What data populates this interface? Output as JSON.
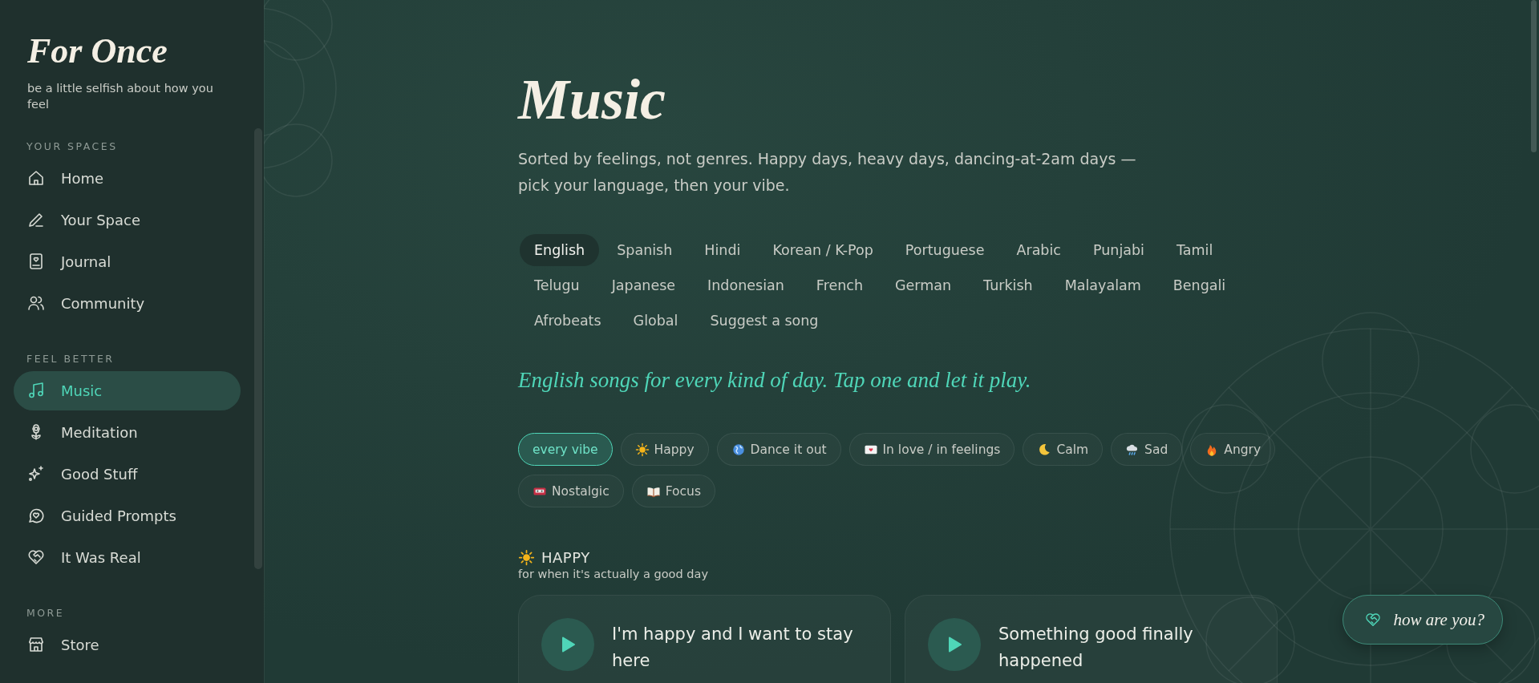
{
  "brand": {
    "title": "For Once",
    "tagline": "be a little selfish about how you feel"
  },
  "sidebar": {
    "sections": [
      {
        "heading": "YOUR SPACES",
        "items": [
          {
            "label": "Home",
            "kind": "home",
            "selected": false
          },
          {
            "label": "Your Space",
            "kind": "pencil",
            "selected": false
          },
          {
            "label": "Journal",
            "kind": "journal",
            "selected": false
          },
          {
            "label": "Community",
            "kind": "people",
            "selected": false
          }
        ]
      },
      {
        "heading": "FEEL BETTER",
        "items": [
          {
            "label": "Music",
            "kind": "music",
            "selected": true
          },
          {
            "label": "Meditation",
            "kind": "flower",
            "selected": false
          },
          {
            "label": "Good Stuff",
            "kind": "sparkles",
            "selected": false
          },
          {
            "label": "Guided Prompts",
            "kind": "chat",
            "selected": false
          },
          {
            "label": "It Was Real",
            "kind": "heart",
            "selected": false
          }
        ]
      },
      {
        "heading": "MORE",
        "items": [
          {
            "label": "Store",
            "kind": "store",
            "selected": false
          }
        ]
      }
    ]
  },
  "page": {
    "title": "Music",
    "intro": "Sorted by feelings, not genres. Happy days, heavy days, dancing-at-2am days — pick your language, then your vibe.",
    "languages": [
      {
        "label": "English",
        "selected": true
      },
      {
        "label": "Spanish",
        "selected": false
      },
      {
        "label": "Hindi",
        "selected": false
      },
      {
        "label": "Korean / K-Pop",
        "selected": false
      },
      {
        "label": "Portuguese",
        "selected": false
      },
      {
        "label": "Arabic",
        "selected": false
      },
      {
        "label": "Punjabi",
        "selected": false
      },
      {
        "label": "Tamil",
        "selected": false
      },
      {
        "label": "Telugu",
        "selected": false
      },
      {
        "label": "Japanese",
        "selected": false
      },
      {
        "label": "Indonesian",
        "selected": false
      },
      {
        "label": "French",
        "selected": false
      },
      {
        "label": "German",
        "selected": false
      },
      {
        "label": "Turkish",
        "selected": false
      },
      {
        "label": "Malayalam",
        "selected": false
      },
      {
        "label": "Bengali",
        "selected": false
      },
      {
        "label": "Afrobeats",
        "selected": false
      },
      {
        "label": "Global",
        "selected": false
      },
      {
        "label": "Suggest a song",
        "selected": false
      }
    ],
    "tagline": "English songs for every kind of day. Tap one and let it play.",
    "moods": [
      {
        "label": "every vibe",
        "kind": "plain",
        "selected": true
      },
      {
        "label": "Happy",
        "kind": "sun",
        "selected": false
      },
      {
        "label": "Dance it out",
        "kind": "globe",
        "selected": false
      },
      {
        "label": "In love / in feelings",
        "kind": "envelope",
        "selected": false
      },
      {
        "label": "Calm",
        "kind": "moon",
        "selected": false
      },
      {
        "label": "Sad",
        "kind": "rain",
        "selected": false
      },
      {
        "label": "Angry",
        "kind": "flame",
        "selected": false
      },
      {
        "label": "Nostalgic",
        "kind": "cassette",
        "selected": false
      },
      {
        "label": "Focus",
        "kind": "book",
        "selected": false
      }
    ],
    "section": {
      "kind": "sun",
      "title": "HAPPY",
      "subtitle": "for when it's actually a good day"
    },
    "songs": [
      {
        "title": "I'm happy and I want to stay here"
      },
      {
        "title": "Something good finally happened"
      }
    ]
  },
  "fab": {
    "label": "how are you?"
  }
}
